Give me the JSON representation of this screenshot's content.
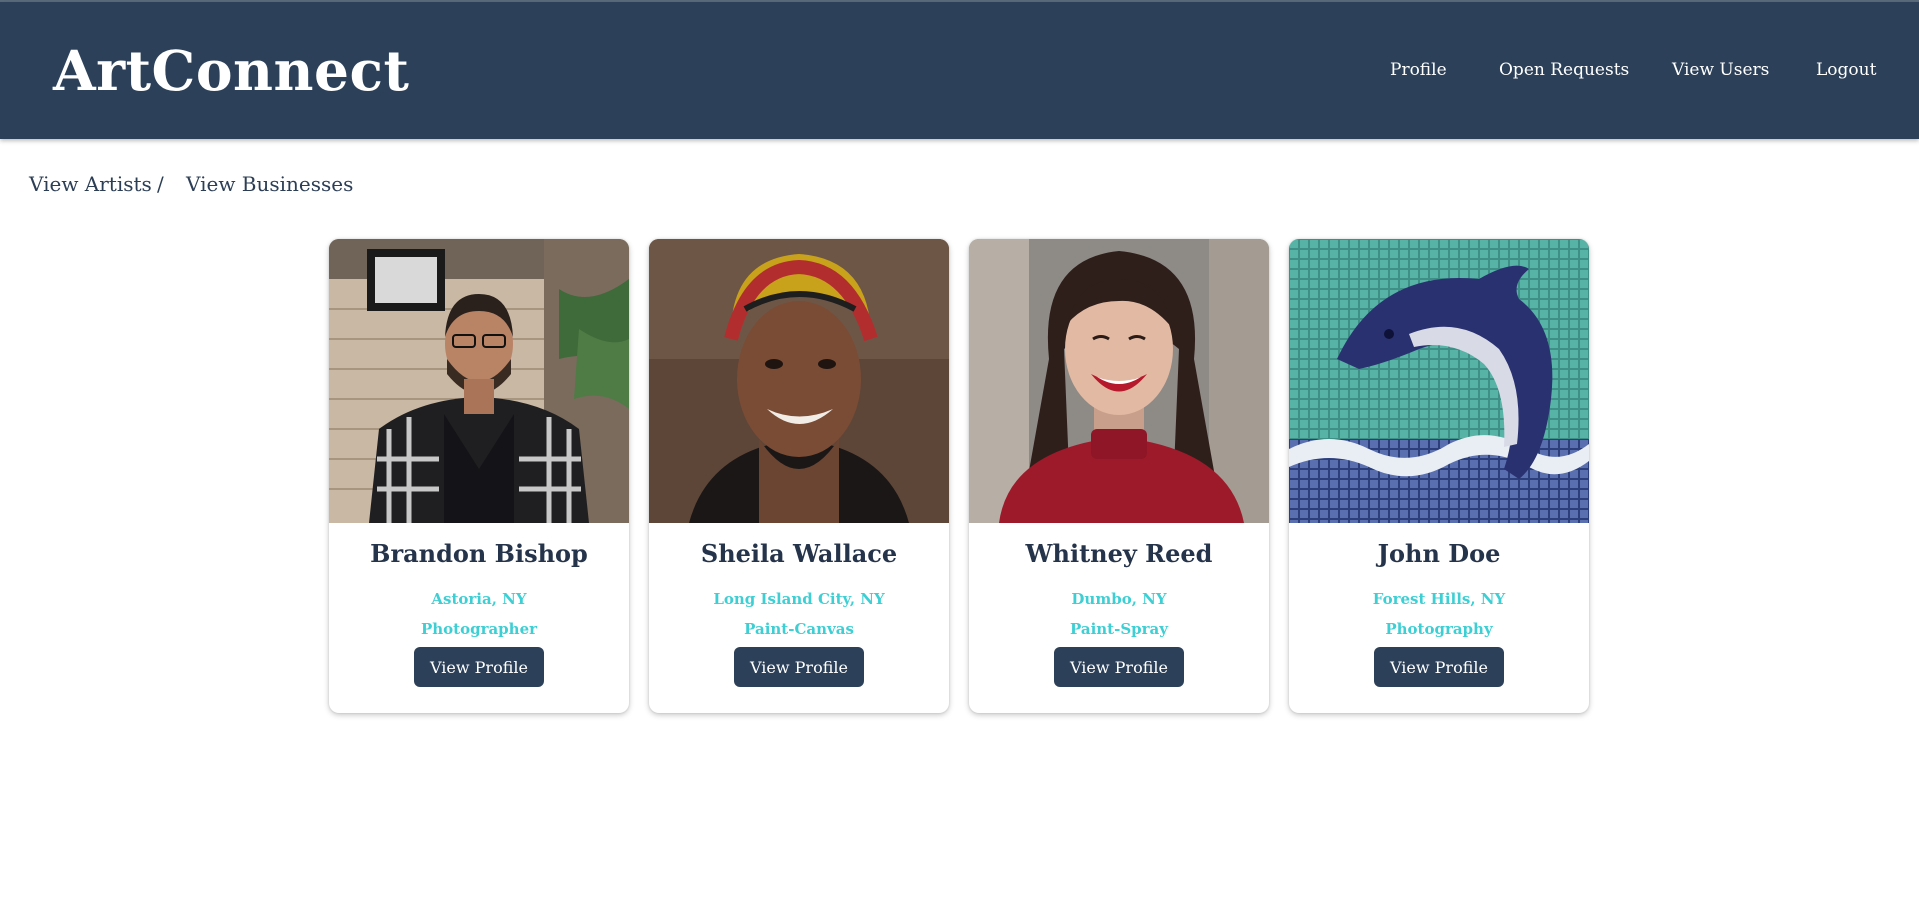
{
  "app": {
    "brand": "ArtConnect"
  },
  "nav": {
    "items": [
      {
        "label": "Profile"
      },
      {
        "label": "Open Requests"
      },
      {
        "label": "View Users"
      },
      {
        "label": "Logout"
      }
    ]
  },
  "breadcrumb": {
    "first": "View Artists",
    "separator": "/",
    "second": "View Businesses"
  },
  "cards": [
    {
      "name": "Brandon Bishop",
      "location": "Astoria, NY",
      "role": "Photographer",
      "button": "View Profile",
      "photo": "man-in-plaid-shirt-portrait"
    },
    {
      "name": "Sheila Wallace",
      "location": "Long Island City, NY",
      "role": "Paint-Canvas",
      "button": "View Profile",
      "photo": "woman-in-headwrap-portrait"
    },
    {
      "name": "Whitney Reed",
      "location": "Dumbo, NY",
      "role": "Paint-Spray",
      "button": "View Profile",
      "photo": "woman-in-red-sweater-portrait"
    },
    {
      "name": "John Doe",
      "location": "Forest Hills, NY",
      "role": "Photography",
      "button": "View Profile",
      "photo": "dolphin-mosaic-artwork"
    }
  ],
  "colors": {
    "navbar": "#2c4159",
    "accent": "#3ecfd4",
    "name_text": "#25344a",
    "button": "#2c4159"
  }
}
